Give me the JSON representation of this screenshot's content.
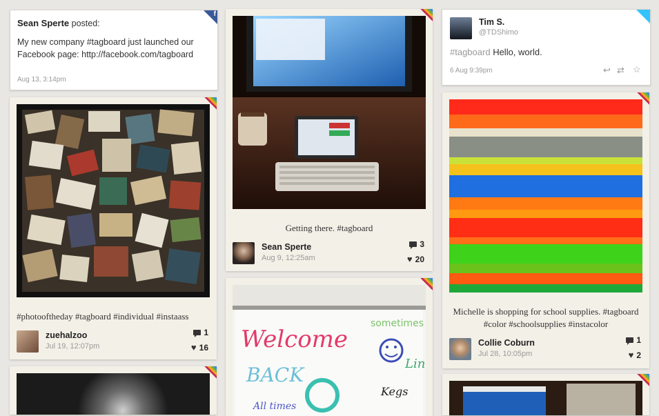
{
  "fb_post": {
    "author": "Sean Sperte",
    "action": "posted:",
    "text": "My new company #tagboard just launched our Facebook page: http://facebook.com/tagboard",
    "time": "Aug 13, 3:14pm",
    "network_icon": "facebook-icon"
  },
  "tw_post": {
    "name": "Tim S.",
    "handle": "@TDShimo",
    "hashtag": "#tagboard",
    "text": "Hello, world.",
    "time": "6 Aug 9:39pm",
    "actions": [
      "reply-icon",
      "retweet-icon",
      "favorite-icon"
    ],
    "network_icon": "twitter-icon"
  },
  "ig1": {
    "caption": "#photooftheday #tagboard #individual #instaass",
    "user": "zuehalzoo",
    "time": "Jul 19, 12:07pm",
    "comments": "1",
    "likes": "16"
  },
  "ig2": {
    "caption": "Getting there. #tagboard",
    "user": "Sean Sperte",
    "time": "Aug 9, 12:25am",
    "comments": "3",
    "likes": "20"
  },
  "ig3": {
    "caption": "Michelle is shopping for school supplies. #tagboard #color #schoolsupplies #instacolor",
    "user": "Collie Coburn",
    "time": "Jul 28, 10:05pm",
    "comments": "1",
    "likes": "2"
  },
  "colors": {
    "facebook": "#3b5998",
    "twitter": "#33c4ff",
    "hashtag": "#999999",
    "background": "#e9e7e3"
  }
}
